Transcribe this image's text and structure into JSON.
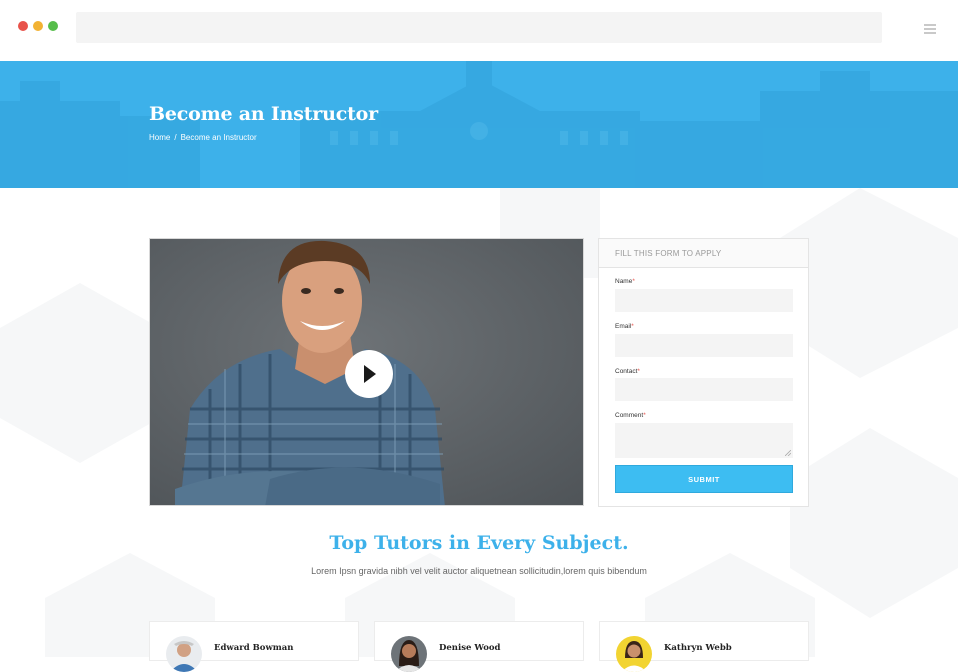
{
  "browser": {
    "dots": [
      "#e8524a",
      "#f2b233",
      "#56bd4a"
    ]
  },
  "hero": {
    "title": "Become an Instructor",
    "breadcrumb": {
      "home": "Home",
      "separator": "/",
      "current": "Become an Instructor"
    },
    "background_color": "#3db1ea"
  },
  "video": {
    "play_icon": "play-icon"
  },
  "form": {
    "header": "FILL THIS FORM TO APPLY",
    "fields": {
      "name": {
        "label": "Name",
        "required_mark": "*"
      },
      "email": {
        "label": "Email",
        "required_mark": "*"
      },
      "contact": {
        "label": "Contact",
        "required_mark": "*"
      },
      "comment": {
        "label": "Comment",
        "required_mark": "*"
      }
    },
    "submit_label": "SUBMIT",
    "accent": "#3dbdf2"
  },
  "tutors_section": {
    "title": "Top Tutors in Every Subject.",
    "subtitle": "Lorem Ipsn gravida nibh vel velit auctor aliquetnean sollicitudin,lorem quis bibendum",
    "tutors": [
      {
        "name": "Edward Bowman"
      },
      {
        "name": "Denise Wood"
      },
      {
        "name": "Kathryn Webb"
      }
    ]
  }
}
